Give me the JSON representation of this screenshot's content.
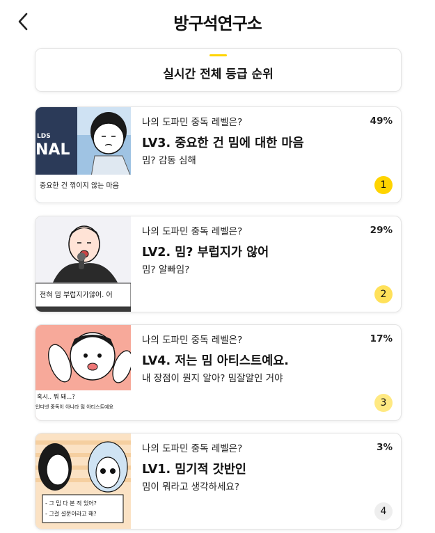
{
  "header": {
    "logo_text": "방구석연구소",
    "back_icon": "chevron-left-icon"
  },
  "title_card": {
    "title": "실시간 전체 등급 순위",
    "accent_color": "#FFD400"
  },
  "results": [
    {
      "question": "나의 도파민 중독 레벨은?",
      "percent": "49%",
      "level_title": "LV3. 중요한 건 밈에 대한 마음",
      "subtitle": "밈? 감동 심해",
      "rank": "1",
      "thumb_caption": "중요한 건 꺾이지 않는 마음",
      "thumb_text": "NAL",
      "thumb_text_small": "LDS"
    },
    {
      "question": "나의 도파민 중독 레벨은?",
      "percent": "29%",
      "level_title": "LV2. 밈? 부럽지가 않어",
      "subtitle": "밈? 알빠임?",
      "rank": "2",
      "thumb_caption": "전혀 밈 부럽지가않어. 어"
    },
    {
      "question": "나의 도파민 중독 레벨은?",
      "percent": "17%",
      "level_title": "LV4. 저는 밈 아티스트예요.",
      "subtitle": "내 장점이 뭔지 알아? 밈잘알인 거야",
      "rank": "3",
      "thumb_caption_1": "혹시.. 뭐 돼...?",
      "thumb_caption_2": "인디넷 중독이 아니라 밈 아티스트예요"
    },
    {
      "question": "나의 도파민 중독 레벨은?",
      "percent": "3%",
      "level_title": "LV1. 밈기적 갓반인",
      "subtitle": "밈이 뭐라고 생각하세요?",
      "rank": "4",
      "thumb_caption_1": "- 그 밈 다 본 적 있어?",
      "thumb_caption_2": "- 그걸 설문이라고 해?"
    }
  ],
  "colors": {
    "rank_1": "#FFD400",
    "rank_2": "#FFE15A",
    "rank_3": "#FFE982",
    "rank_4": "#EEEEEE"
  }
}
